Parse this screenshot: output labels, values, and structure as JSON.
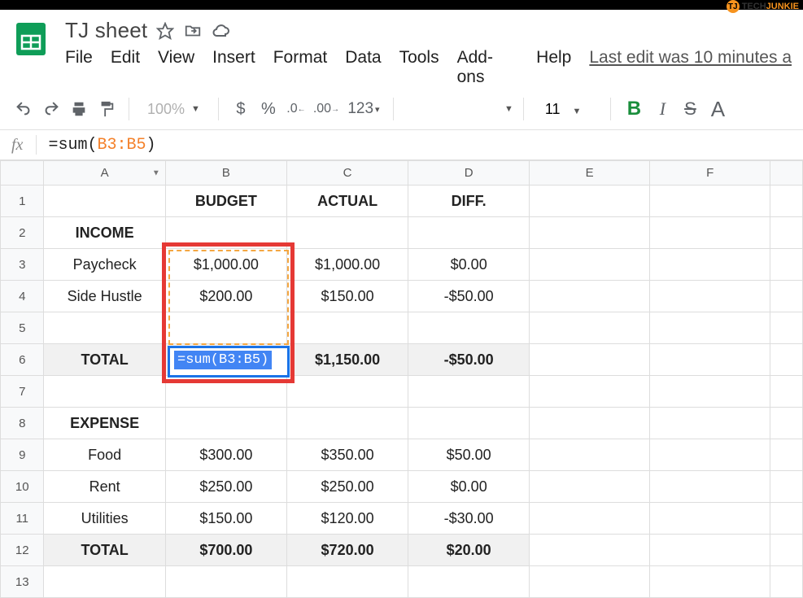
{
  "watermark": {
    "part1": "TECH",
    "part2": "JUNKIE",
    "icon": "TJ"
  },
  "doc_title": "TJ sheet",
  "menubar": [
    "File",
    "Edit",
    "View",
    "Insert",
    "Format",
    "Data",
    "Tools",
    "Add-ons",
    "Help"
  ],
  "last_edit": "Last edit was 10 minutes a",
  "toolbar": {
    "zoom": "100%",
    "font_size": "11",
    "num_format": "123"
  },
  "formula": {
    "prefix": "=sum(",
    "range": "B3:B5",
    "suffix": ")"
  },
  "columns": [
    "A",
    "B",
    "C",
    "D",
    "E",
    "F"
  ],
  "rows": {
    "1": {
      "A": "",
      "B": "BUDGET",
      "C": "ACTUAL",
      "D": "DIFF."
    },
    "2": {
      "A": "INCOME"
    },
    "3": {
      "A": "Paycheck",
      "B": "$1,000.00",
      "C": "$1,000.00",
      "D": "$0.00"
    },
    "4": {
      "A": "Side Hustle",
      "B": "$200.00",
      "C": "$150.00",
      "D": "-$50.00"
    },
    "5": {},
    "6": {
      "A": "TOTAL",
      "B_formula": "=sum(B3:B5)",
      "C": "$1,150.00",
      "D": "-$50.00"
    },
    "7": {},
    "8": {
      "A": "EXPENSE"
    },
    "9": {
      "A": "Food",
      "B": "$300.00",
      "C": "$350.00",
      "D": "$50.00"
    },
    "10": {
      "A": "Rent",
      "B": "$250.00",
      "C": "$250.00",
      "D": "$0.00"
    },
    "11": {
      "A": "Utilities",
      "B": "$150.00",
      "C": "$120.00",
      "D": "-$30.00"
    },
    "12": {
      "A": "TOTAL",
      "B": "$700.00",
      "C": "$720.00",
      "D": "$20.00"
    },
    "13": {}
  }
}
